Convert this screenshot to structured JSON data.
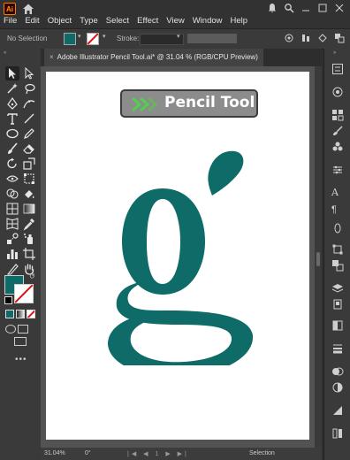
{
  "app": {
    "logo_text": "Ai"
  },
  "menu": {
    "items": [
      "File",
      "Edit",
      "Object",
      "Type",
      "Select",
      "Effect",
      "View",
      "Window",
      "Help"
    ]
  },
  "control_bar": {
    "selection_status": "No Selection",
    "fill_color": "#0e6b67",
    "stroke_label": "Stroke:",
    "stroke_value": ""
  },
  "document_tab": {
    "title": "Adobe Illustrator Pencil Tool.ai* @ 31.04 % (RGB/CPU Preview)",
    "close_glyph": "×"
  },
  "artwork": {
    "banner_text": "Pencil Tool",
    "glyph_color": "#0e6b67",
    "banner_bg": "#8c8c8c",
    "arrow_color": "#4fd14a"
  },
  "status_bar": {
    "zoom": "31.04%",
    "rotation": "0°",
    "page_nav": "|◀ ◀ 1 ▶ ▶|",
    "status_text": "Selection"
  },
  "tools": [
    "selection-tool-icon",
    "direct-selection-tool-icon",
    "magic-wand-tool-icon",
    "lasso-tool-icon",
    "pen-tool-icon",
    "curvature-tool-icon",
    "type-tool-icon",
    "line-tool-icon",
    "ellipse-tool-icon",
    "pencil-tool-icon",
    "paintbrush-tool-icon",
    "eraser-tool-icon",
    "rotate-tool-icon",
    "scale-tool-icon",
    "width-tool-icon",
    "free-transform-tool-icon",
    "shape-builder-tool-icon",
    "live-paint-tool-icon",
    "perspective-grid-tool-icon",
    "gradient-tool-icon",
    "mesh-tool-icon",
    "eyedropper-tool-icon",
    "blend-tool-icon",
    "symbol-sprayer-tool-icon",
    "column-graph-tool-icon",
    "artboard-tool-icon",
    "slice-tool-icon",
    "hand-tool-icon",
    "zoom-tool-icon"
  ]
}
